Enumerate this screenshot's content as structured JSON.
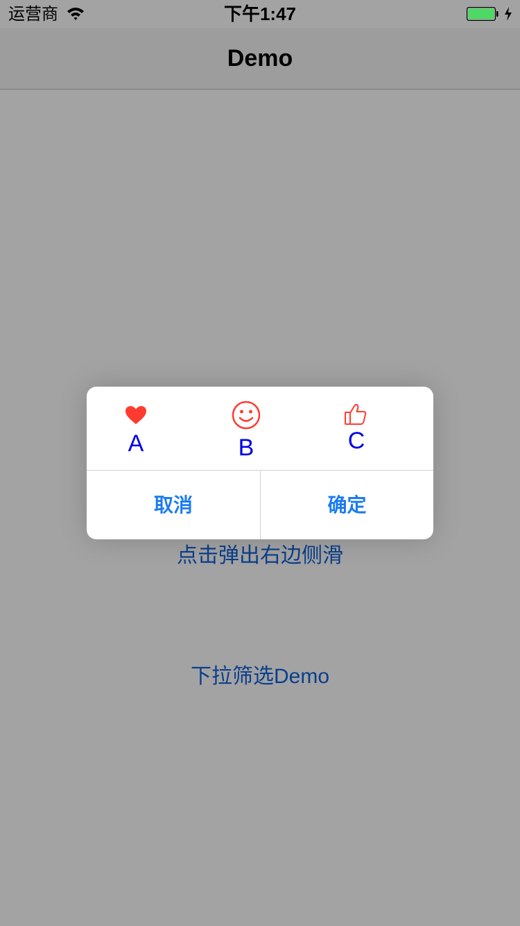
{
  "status_bar": {
    "carrier": "运营商",
    "time": "下午1:47",
    "battery_color": "#4cd964"
  },
  "nav": {
    "title": "Demo"
  },
  "page": {
    "links": [
      {
        "label": "点击弹出右边侧滑"
      },
      {
        "label": "下拉筛选Demo"
      }
    ],
    "link_color": "#0a3e8c"
  },
  "dialog": {
    "options": [
      {
        "icon": "heart-icon",
        "label": "A",
        "icon_color": "#ff3b30"
      },
      {
        "icon": "smiley-icon",
        "label": "B",
        "icon_color": "#ff3b30"
      },
      {
        "icon": "thumbs-up-icon",
        "label": "C",
        "icon_color": "#ff3b30"
      }
    ],
    "cancel_label": "取消",
    "confirm_label": "确定",
    "button_color": "#1b7cf2",
    "label_color": "#0000e6"
  }
}
